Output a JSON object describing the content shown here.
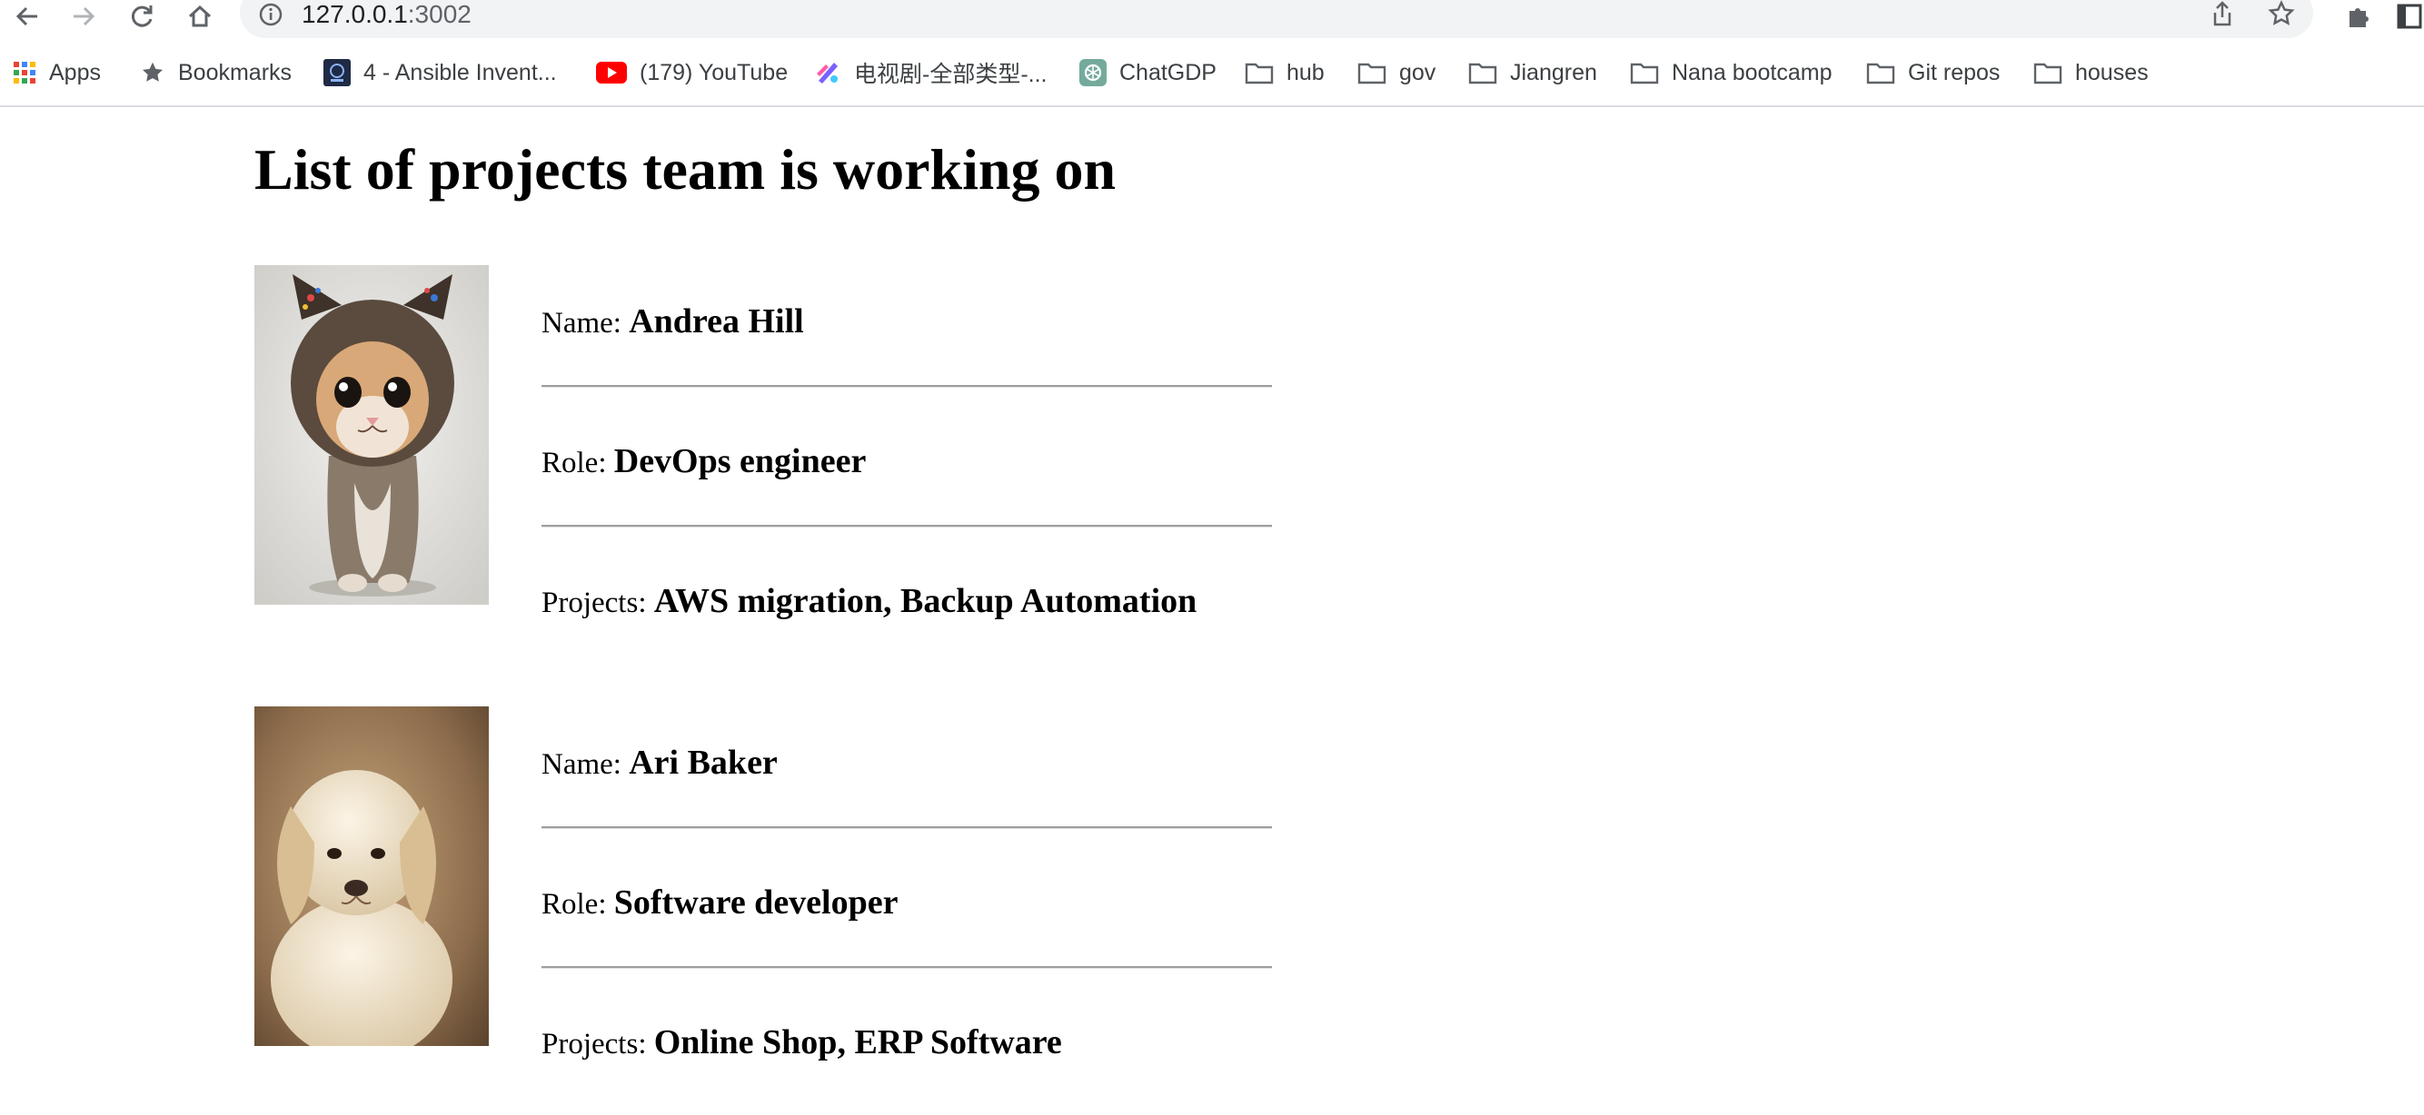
{
  "browser": {
    "url_host": "127.0.0.1",
    "url_port": ":3002"
  },
  "bookmarks": [
    {
      "label": "Apps",
      "icon": "apps-grid-icon"
    },
    {
      "label": "Bookmarks",
      "icon": "star-icon"
    },
    {
      "label": "4 - Ansible Invent...",
      "icon": "site-favicon"
    },
    {
      "label": "(179) YouTube",
      "icon": "youtube-icon"
    },
    {
      "label": "电视剧-全部类型-...",
      "icon": "site-favicon"
    },
    {
      "label": "ChatGDP",
      "icon": "chatgpt-icon"
    },
    {
      "label": "hub",
      "icon": "folder-icon"
    },
    {
      "label": "gov",
      "icon": "folder-icon"
    },
    {
      "label": "Jiangren",
      "icon": "folder-icon"
    },
    {
      "label": "Nana bootcamp",
      "icon": "folder-icon"
    },
    {
      "label": "Git repos",
      "icon": "folder-icon"
    },
    {
      "label": "houses",
      "icon": "folder-icon"
    }
  ],
  "page": {
    "title": "List of projects team is working on"
  },
  "members": [
    {
      "name_label": "Name:",
      "name": "Andrea Hill",
      "role_label": "Role:",
      "role": "DevOps engineer",
      "projects_label": "Projects:",
      "projects": "AWS migration, Backup Automation",
      "photo": "kitten-in-hood"
    },
    {
      "name_label": "Name:",
      "name": "Ari Baker",
      "role_label": "Role:",
      "role": "Software developer",
      "projects_label": "Projects:",
      "projects": "Online Shop, ERP Software",
      "photo": "puppy"
    }
  ]
}
